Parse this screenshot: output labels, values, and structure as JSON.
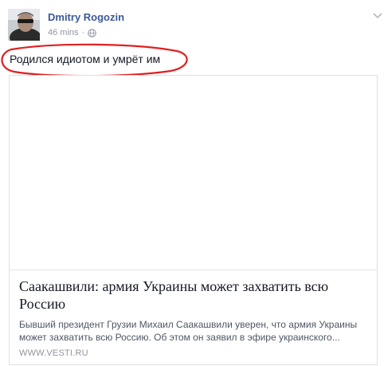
{
  "post": {
    "author": "Dmitry Rogozin",
    "time": "46 mins",
    "separator": "·",
    "privacy_icon": "globe-icon",
    "menu_icon": "chevron-down-icon",
    "text": "Родился идиотом и умрёт им"
  },
  "link": {
    "title": "Саакашвили: армия Украины может захватить всю Россию",
    "description": "Бывший президент Грузии Михаил Саакашвили уверен, что армия Украины может захватить всю Россию. Об этом он заявил в эфире украинского...",
    "domain": "WWW.VESTI.RU"
  },
  "colors": {
    "author_link": "#3b5998",
    "meta_text": "#9197a3",
    "annotation_ellipse": "#e02020"
  }
}
